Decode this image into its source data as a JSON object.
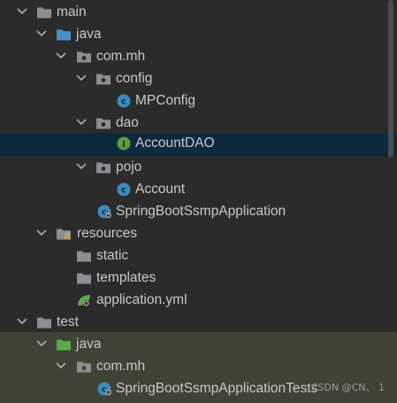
{
  "project_tree": {
    "items": [
      {
        "label": "main",
        "icon": "folder-icon"
      },
      {
        "label": "java",
        "icon": "source-folder-icon"
      },
      {
        "label": "com.mh",
        "icon": "package-icon"
      },
      {
        "label": "config",
        "icon": "package-icon"
      },
      {
        "label": "MPConfig",
        "icon": "class-icon"
      },
      {
        "label": "dao",
        "icon": "package-icon"
      },
      {
        "label": "AccountDAO",
        "icon": "interface-icon"
      },
      {
        "label": "pojo",
        "icon": "package-icon"
      },
      {
        "label": "Account",
        "icon": "class-icon"
      },
      {
        "label": "SpringBootSsmpApplication",
        "icon": "spring-boot-class-icon"
      },
      {
        "label": "resources",
        "icon": "resources-folder-icon"
      },
      {
        "label": "static",
        "icon": "folder-icon"
      },
      {
        "label": "templates",
        "icon": "folder-icon"
      },
      {
        "label": "application.yml",
        "icon": "spring-config-icon"
      },
      {
        "label": "test",
        "icon": "folder-icon"
      },
      {
        "label": "java",
        "icon": "test-source-folder-icon"
      },
      {
        "label": "com.mh",
        "icon": "package-icon"
      },
      {
        "label": "SpringBootSsmpApplicationTests",
        "icon": "spring-boot-test-class-icon"
      }
    ],
    "selected_item": "AccountDAO"
  },
  "watermark": "CSDN @CN、 1",
  "colors": {
    "background": "#2b2b2b",
    "selection": "#0d293e",
    "test_root": "#3e4336",
    "folder": "#8b8e92",
    "source_folder": "#4a8fc8",
    "test_folder": "#5ba847",
    "class": "#3b8cbf",
    "interface": "#5a9c3e"
  }
}
